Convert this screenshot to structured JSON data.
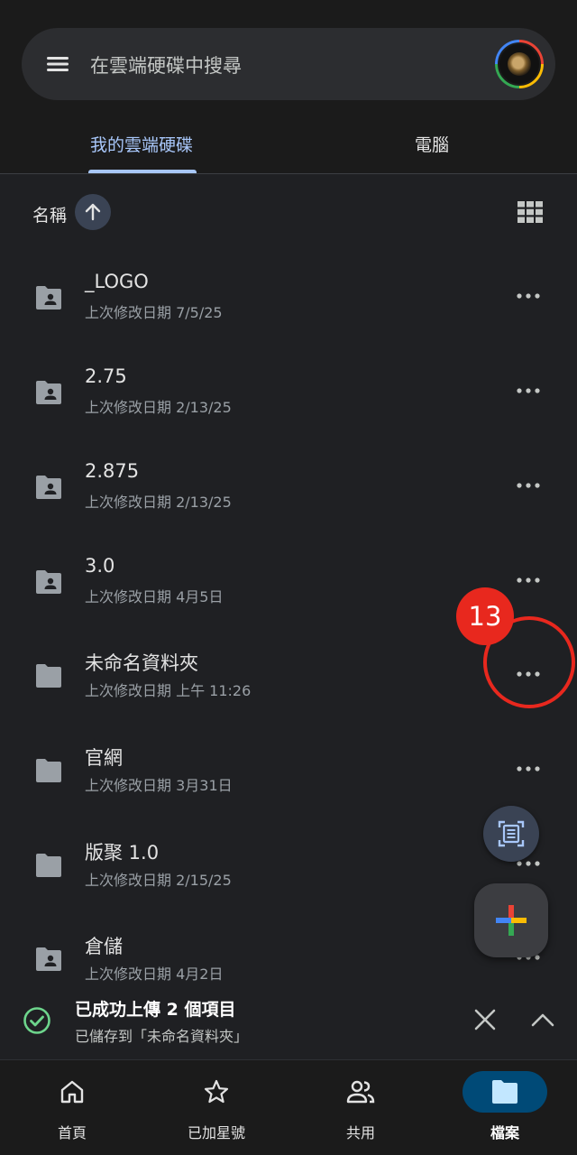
{
  "search": {
    "placeholder": "在雲端硬碟中搜尋"
  },
  "tabs": [
    {
      "label": "我的雲端硬碟",
      "active": true
    },
    {
      "label": "電腦",
      "active": false
    }
  ],
  "sort": {
    "label": "名稱",
    "direction": "ascending"
  },
  "files": [
    {
      "name": "_LOGO",
      "meta": "上次修改日期 7/5/25",
      "icon": "shared-folder-icon"
    },
    {
      "name": "2.75",
      "meta": "上次修改日期 2/13/25",
      "icon": "shared-folder-icon"
    },
    {
      "name": "2.875",
      "meta": "上次修改日期 2/13/25",
      "icon": "shared-folder-icon"
    },
    {
      "name": "3.0",
      "meta": "上次修改日期 4月5日",
      "icon": "shared-folder-icon"
    },
    {
      "name": "未命名資料夾",
      "meta": "上次修改日期 上午 11:26",
      "icon": "folder-icon"
    },
    {
      "name": "官網",
      "meta": "上次修改日期 3月31日",
      "icon": "folder-icon"
    },
    {
      "name": "版聚 1.0",
      "meta": "上次修改日期 2/15/25",
      "icon": "folder-icon"
    },
    {
      "name": "倉儲",
      "meta": "上次修改日期 4月2日",
      "icon": "shared-folder-icon"
    }
  ],
  "annotation": {
    "badge": "13"
  },
  "snackbar": {
    "title": "已成功上傳 2 個項目",
    "subtitle": "已儲存到「未命名資料夾」"
  },
  "bottom_nav": [
    {
      "label": "首頁",
      "icon": "home-icon",
      "active": false
    },
    {
      "label": "已加星號",
      "icon": "star-icon",
      "active": false
    },
    {
      "label": "共用",
      "icon": "people-icon",
      "active": false
    },
    {
      "label": "檔案",
      "icon": "folder-icon",
      "active": true
    }
  ],
  "colors": {
    "accent": "#a8c7fa",
    "annotation": "#e8281e",
    "success": "#6dd58c",
    "nav_active_bg": "#004a77"
  }
}
